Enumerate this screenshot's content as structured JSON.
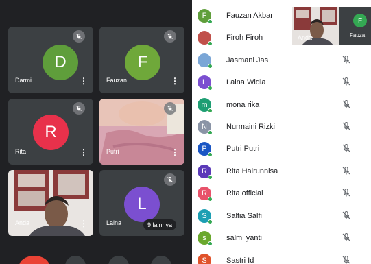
{
  "tiles": [
    {
      "name": "Darmi",
      "initial": "D",
      "color": "#5f9e3b"
    },
    {
      "name": "Fauzan",
      "initial": "F",
      "color": "#6fa83a"
    },
    {
      "name": "Rita",
      "initial": "R",
      "color": "#e8314b"
    },
    {
      "name": "Putri"
    },
    {
      "name": "Anda"
    },
    {
      "name": "Laina",
      "initial": "L",
      "color": "#7b4fd0",
      "more_label": "9 lainnya"
    }
  ],
  "participants": [
    {
      "name": "Fauzan Akbar",
      "initial": "F",
      "color": "#5f9e3b"
    },
    {
      "name": "Firoh Firoh",
      "initial": "",
      "color": "#c0504a"
    },
    {
      "name": "Jasmani Jas",
      "initial": "",
      "color": "#7aa6d6"
    },
    {
      "name": "Laina Widia",
      "initial": "L",
      "color": "#7b4fd0"
    },
    {
      "name": "mona rika",
      "initial": "m",
      "color": "#1e9e73"
    },
    {
      "name": "Nurmaini Rizki",
      "initial": "N",
      "color": "#8a94a6"
    },
    {
      "name": "Putri Putri",
      "initial": "P",
      "color": "#1a56c4"
    },
    {
      "name": "Rita Hairunnisa",
      "initial": "R",
      "color": "#5b3ab8"
    },
    {
      "name": "Rita official",
      "initial": "R",
      "color": "#e8526a"
    },
    {
      "name": "Salfia Salfi",
      "initial": "S",
      "color": "#1c9fb3"
    },
    {
      "name": "salmi yanti",
      "initial": "s",
      "color": "#6aa82d"
    },
    {
      "name": "Sastri Id",
      "initial": "S",
      "color": "#e0522a"
    }
  ],
  "self_view": {
    "label": "Anda",
    "other_initial": "F",
    "other_name": "Fauza"
  },
  "icons": {
    "mute": "mic-off-icon",
    "more": "more-vert-icon"
  }
}
